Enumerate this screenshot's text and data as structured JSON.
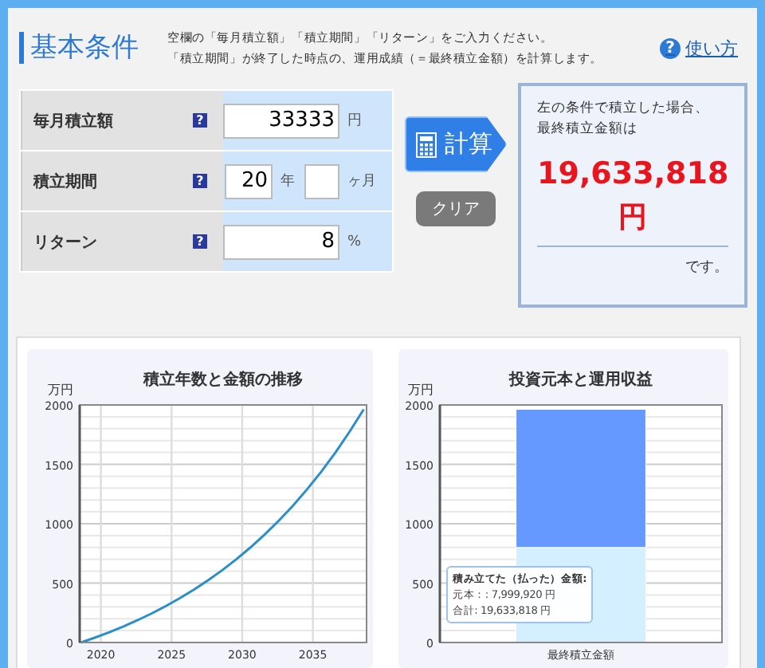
{
  "header": {
    "title": "基本条件",
    "instructions": [
      "空欄の「毎月積立額」「積立期間」「リターン」をご入力ください。",
      "「積立期間」が終了した時点の、運用成績（＝最終積立金額）を計算します。"
    ],
    "help_icon": "?",
    "help_link": "使い方"
  },
  "form": {
    "rows": [
      {
        "kind": "single",
        "label": "毎月積立額",
        "help": "?",
        "value": "33333",
        "unit": "円"
      },
      {
        "kind": "period",
        "label": "積立期間",
        "help": "?",
        "years": "20",
        "years_unit": "年",
        "months_unit": "ヶ月"
      },
      {
        "kind": "single",
        "label": "リターン",
        "help": "?",
        "value": "8",
        "unit": "%"
      }
    ]
  },
  "buttons": {
    "calculate": "計算",
    "clear": "クリア"
  },
  "result": {
    "intro": [
      "左の条件で積立した場合、",
      "最終積立金額は"
    ],
    "amount": "19,633,818",
    "currency": "円",
    "suffix": "です。"
  },
  "charts": [
    {
      "chart_data": {
        "type": "line",
        "title": "積立年数と金額の推移",
        "ylabel": "万円",
        "x": [
          2018.6,
          2019.6,
          2020.6,
          2021.6,
          2022.6,
          2023.6,
          2024.6,
          2025.6,
          2026.6,
          2027.6,
          2028.6,
          2029.6,
          2030.6,
          2031.6,
          2032.6,
          2033.6,
          2034.6,
          2035.6,
          2036.6,
          2037.6,
          2038.6
        ],
        "grid": true,
        "series": [
          {
            "color": "#2a8fc8",
            "values": [
              0,
              42,
              86,
              135,
              188,
              245,
              307,
              374,
              446,
              525,
              610,
              702,
              802,
              910,
              1027,
              1153,
              1291,
              1439,
              1600,
              1775,
              1963
            ]
          }
        ],
        "xlim": [
          2018.5,
          2038.8
        ],
        "ylim": [
          0,
          2000
        ],
        "xticks": [
          2020,
          2025,
          2030,
          2035
        ],
        "yticks": [
          0,
          500,
          1000,
          1500,
          2000
        ]
      }
    },
    {
      "chart_data": {
        "type": "bar",
        "title": "投資元本と運用収益",
        "ylabel": "万円",
        "categories": [
          "最終積立金額"
        ],
        "stacked": true,
        "grid": true,
        "series": [
          {
            "color": "#d4efff",
            "values": [
              800
            ]
          },
          {
            "color": "#6699ff",
            "values": [
              1163
            ]
          }
        ],
        "ylim": [
          0,
          2000
        ],
        "yticks": [
          0,
          500,
          1000,
          1500,
          2000
        ]
      },
      "tooltip": {
        "title": "積み立てた（払った）金額:",
        "lines": [
          "元本：: 7,999,920 円",
          "合計: 19,633,818 円"
        ]
      }
    }
  ]
}
